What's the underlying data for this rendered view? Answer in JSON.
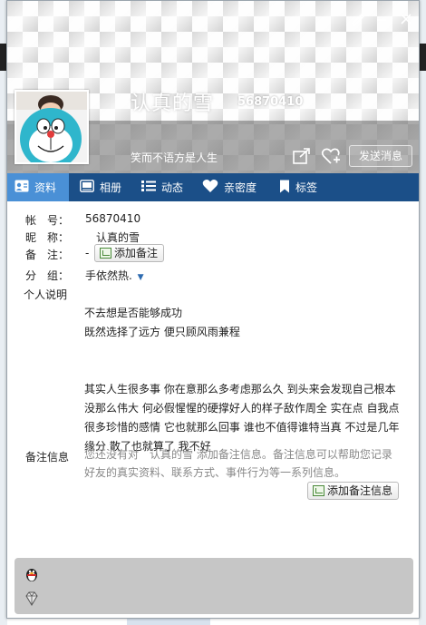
{
  "window": {
    "title_buttons": {
      "skin_icon": "brush-icon",
      "minimize_icon": "minimize-icon",
      "close_icon": "close-icon"
    }
  },
  "profile": {
    "nickname": "认真的雪",
    "qq_number": "56870410",
    "signature": "笑而不语方是人生",
    "send_message_label": "发送消息",
    "share_icon": "share-icon",
    "add_friend_icon": "heart-plus-icon"
  },
  "tabs": [
    {
      "label": "资料",
      "icon": "profile-card-icon",
      "active": true
    },
    {
      "label": "相册",
      "icon": "photo-icon",
      "active": false
    },
    {
      "label": "动态",
      "icon": "feed-list-icon",
      "active": false
    },
    {
      "label": "亲密度",
      "icon": "heart-icon",
      "active": false
    },
    {
      "label": "标签",
      "icon": "bookmark-icon",
      "active": false
    }
  ],
  "fields": {
    "account_label": "帐　号：",
    "account_value": "56870410",
    "nickname_label": "昵　称：",
    "nickname_value": "认真的雪",
    "remark_label": "备　注：",
    "remark_value": "-",
    "add_remark_label": "添加备注",
    "group_label": "分　组：",
    "group_value": "手依然热.",
    "intro_label": "个人说明",
    "intro_text": "不去想是否能够成功\n既然选择了远方 便只顾风雨兼程\n\n\n其实人生很多事 你在意那么多考虑那么久 到头来会发现自己根本没那么伟大 何必假惺惺的硬撑好人的样子敌作周全 实在点 自我点 很多珍惜的感情 它也就那么回事 谁也不值得谁特当真 不过是几年缘分 散了也就算了 我不好",
    "note_label": "备注信息",
    "note_text": "您还没有对　认真的雪 添加备注信息。备注信息可以帮助您记录好友的真实资料、联系方式、事件行为等一系列信息。",
    "add_note_label": "添加备注信息"
  },
  "colors": {
    "tabbar": "#1b4f88",
    "tab_active": "#4a90d6",
    "bottom_panel": "#c6c6c6"
  }
}
